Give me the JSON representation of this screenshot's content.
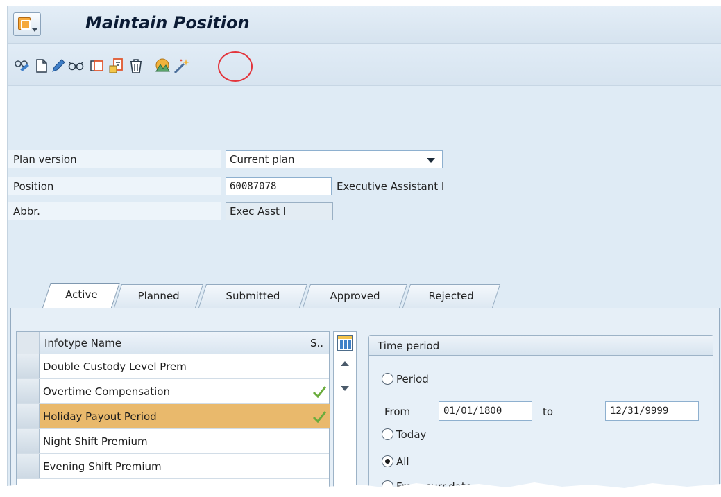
{
  "window": {
    "title": "Maintain Position"
  },
  "toolbar": {
    "icons": [
      "other-object-icon",
      "create-icon",
      "change-icon",
      "display-icon",
      "copy-icon",
      "delimit-icon",
      "delete-icon",
      "overview-icon",
      "wizard-icon"
    ],
    "highlighted_icon": "overview-icon",
    "highlight_color": "#e3343b"
  },
  "fields": {
    "plan_version": {
      "label": "Plan version",
      "value": "Current plan"
    },
    "position": {
      "label": "Position",
      "value": "60087078",
      "description": "Executive Assistant I"
    },
    "abbr": {
      "label": "Abbr.",
      "value": "Exec Asst I"
    }
  },
  "tabs": [
    {
      "label": "Active",
      "active": true
    },
    {
      "label": "Planned",
      "active": false
    },
    {
      "label": "Submitted",
      "active": false
    },
    {
      "label": "Approved",
      "active": false
    },
    {
      "label": "Rejected",
      "active": false
    }
  ],
  "infotype_table": {
    "columns": [
      "Infotype Name",
      "S.."
    ],
    "rows": [
      {
        "name": "Double Custody Level Prem",
        "status": ""
      },
      {
        "name": "Overtime Compensation",
        "status": "check"
      },
      {
        "name": "Holiday Payout Period",
        "status": "check",
        "selected": true
      },
      {
        "name": "Night Shift Premium",
        "status": ""
      },
      {
        "name": "Evening Shift Premium",
        "status": ""
      }
    ],
    "selected_color": "#e9b96c"
  },
  "time_period": {
    "title": "Time period",
    "options": {
      "period": "Period",
      "today": "Today",
      "all": "All",
      "from_curr_date": "From curr.date"
    },
    "selected": "All",
    "from_label": "From",
    "to_label": "to",
    "from_value": "01/01/1800",
    "to_value": "12/31/9999"
  }
}
